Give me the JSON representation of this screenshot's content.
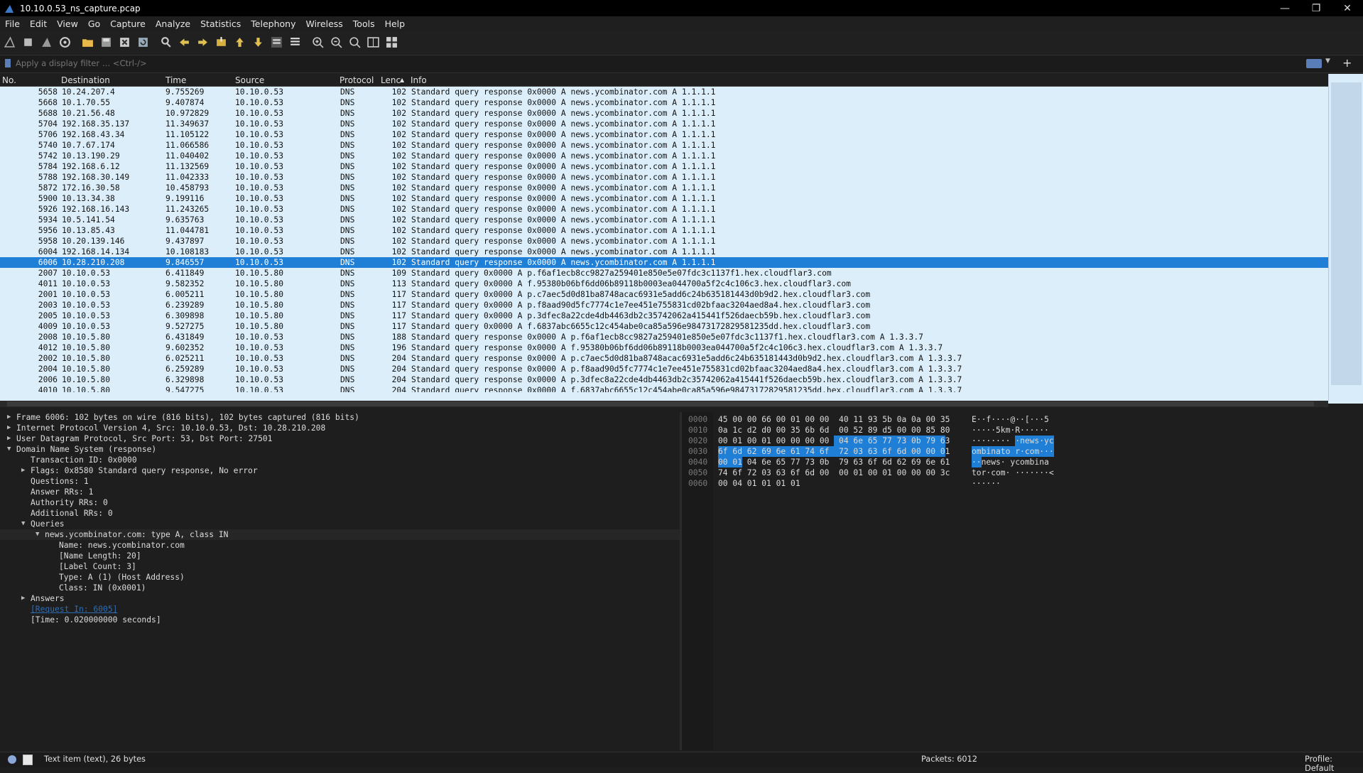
{
  "window": {
    "title": "10.10.0.53_ns_capture.pcap"
  },
  "menu": [
    "File",
    "Edit",
    "View",
    "Go",
    "Capture",
    "Analyze",
    "Statistics",
    "Telephony",
    "Wireless",
    "Tools",
    "Help"
  ],
  "filter": {
    "placeholder": "Apply a display filter … <Ctrl-/>"
  },
  "columns": {
    "no": "No.",
    "destination": "Destination",
    "time": "Time",
    "source": "Source",
    "protocol": "Protocol",
    "length": "Lenc",
    "info": "Info"
  },
  "packets": [
    {
      "no": "5658",
      "dst": "10.24.207.4",
      "time": "9.755269",
      "src": "10.10.0.53",
      "proto": "DNS",
      "len": "102",
      "info": "Standard query response 0x0000 A news.ycombinator.com A 1.1.1.1"
    },
    {
      "no": "5668",
      "dst": "10.1.70.55",
      "time": "9.407874",
      "src": "10.10.0.53",
      "proto": "DNS",
      "len": "102",
      "info": "Standard query response 0x0000 A news.ycombinator.com A 1.1.1.1"
    },
    {
      "no": "5688",
      "dst": "10.21.56.48",
      "time": "10.972829",
      "src": "10.10.0.53",
      "proto": "DNS",
      "len": "102",
      "info": "Standard query response 0x0000 A news.ycombinator.com A 1.1.1.1"
    },
    {
      "no": "5704",
      "dst": "192.168.35.137",
      "time": "11.349637",
      "src": "10.10.0.53",
      "proto": "DNS",
      "len": "102",
      "info": "Standard query response 0x0000 A news.ycombinator.com A 1.1.1.1"
    },
    {
      "no": "5706",
      "dst": "192.168.43.34",
      "time": "11.105122",
      "src": "10.10.0.53",
      "proto": "DNS",
      "len": "102",
      "info": "Standard query response 0x0000 A news.ycombinator.com A 1.1.1.1"
    },
    {
      "no": "5740",
      "dst": "10.7.67.174",
      "time": "11.066586",
      "src": "10.10.0.53",
      "proto": "DNS",
      "len": "102",
      "info": "Standard query response 0x0000 A news.ycombinator.com A 1.1.1.1"
    },
    {
      "no": "5742",
      "dst": "10.13.190.29",
      "time": "11.040402",
      "src": "10.10.0.53",
      "proto": "DNS",
      "len": "102",
      "info": "Standard query response 0x0000 A news.ycombinator.com A 1.1.1.1"
    },
    {
      "no": "5784",
      "dst": "192.168.6.12",
      "time": "11.132569",
      "src": "10.10.0.53",
      "proto": "DNS",
      "len": "102",
      "info": "Standard query response 0x0000 A news.ycombinator.com A 1.1.1.1"
    },
    {
      "no": "5788",
      "dst": "192.168.30.149",
      "time": "11.042333",
      "src": "10.10.0.53",
      "proto": "DNS",
      "len": "102",
      "info": "Standard query response 0x0000 A news.ycombinator.com A 1.1.1.1"
    },
    {
      "no": "5872",
      "dst": "172.16.30.58",
      "time": "10.458793",
      "src": "10.10.0.53",
      "proto": "DNS",
      "len": "102",
      "info": "Standard query response 0x0000 A news.ycombinator.com A 1.1.1.1"
    },
    {
      "no": "5900",
      "dst": "10.13.34.38",
      "time": "9.199116",
      "src": "10.10.0.53",
      "proto": "DNS",
      "len": "102",
      "info": "Standard query response 0x0000 A news.ycombinator.com A 1.1.1.1"
    },
    {
      "no": "5926",
      "dst": "192.168.16.143",
      "time": "11.243265",
      "src": "10.10.0.53",
      "proto": "DNS",
      "len": "102",
      "info": "Standard query response 0x0000 A news.ycombinator.com A 1.1.1.1"
    },
    {
      "no": "5934",
      "dst": "10.5.141.54",
      "time": "9.635763",
      "src": "10.10.0.53",
      "proto": "DNS",
      "len": "102",
      "info": "Standard query response 0x0000 A news.ycombinator.com A 1.1.1.1"
    },
    {
      "no": "5956",
      "dst": "10.13.85.43",
      "time": "11.044781",
      "src": "10.10.0.53",
      "proto": "DNS",
      "len": "102",
      "info": "Standard query response 0x0000 A news.ycombinator.com A 1.1.1.1"
    },
    {
      "no": "5958",
      "dst": "10.20.139.146",
      "time": "9.437897",
      "src": "10.10.0.53",
      "proto": "DNS",
      "len": "102",
      "info": "Standard query response 0x0000 A news.ycombinator.com A 1.1.1.1"
    },
    {
      "no": "6004",
      "dst": "192.168.14.134",
      "time": "10.108183",
      "src": "10.10.0.53",
      "proto": "DNS",
      "len": "102",
      "info": "Standard query response 0x0000 A news.ycombinator.com A 1.1.1.1"
    },
    {
      "no": "6006",
      "dst": "10.28.210.208",
      "time": "9.846557",
      "src": "10.10.0.53",
      "proto": "DNS",
      "len": "102",
      "info": "Standard query response 0x0000 A news.ycombinator.com A 1.1.1.1",
      "selected": true
    },
    {
      "no": "2007",
      "dst": "10.10.0.53",
      "time": "6.411849",
      "src": "10.10.5.80",
      "proto": "DNS",
      "len": "109",
      "info": "Standard query 0x0000 A p.f6af1ecb8cc9827a259401e850e5e07fdc3c1137f1.hex.cloudflar3.com"
    },
    {
      "no": "4011",
      "dst": "10.10.0.53",
      "time": "9.582352",
      "src": "10.10.5.80",
      "proto": "DNS",
      "len": "113",
      "info": "Standard query 0x0000 A f.95380b06bf6dd06b89118b0003ea044700a5f2c4c106c3.hex.cloudflar3.com"
    },
    {
      "no": "2001",
      "dst": "10.10.0.53",
      "time": "6.005211",
      "src": "10.10.5.80",
      "proto": "DNS",
      "len": "117",
      "info": "Standard query 0x0000 A p.c7aec5d0d81ba8748acac6931e5add6c24b635181443d0b9d2.hex.cloudflar3.com"
    },
    {
      "no": "2003",
      "dst": "10.10.0.53",
      "time": "6.239289",
      "src": "10.10.5.80",
      "proto": "DNS",
      "len": "117",
      "info": "Standard query 0x0000 A p.f8aad90d5fc7774c1e7ee451e755831cd02bfaac3204aed8a4.hex.cloudflar3.com"
    },
    {
      "no": "2005",
      "dst": "10.10.0.53",
      "time": "6.309898",
      "src": "10.10.5.80",
      "proto": "DNS",
      "len": "117",
      "info": "Standard query 0x0000 A p.3dfec8a22cde4db4463db2c35742062a415441f526daecb59b.hex.cloudflar3.com"
    },
    {
      "no": "4009",
      "dst": "10.10.0.53",
      "time": "9.527275",
      "src": "10.10.5.80",
      "proto": "DNS",
      "len": "117",
      "info": "Standard query 0x0000 A f.6837abc6655c12c454abe0ca85a596e98473172829581235dd.hex.cloudflar3.com"
    },
    {
      "no": "2008",
      "dst": "10.10.5.80",
      "time": "6.431849",
      "src": "10.10.0.53",
      "proto": "DNS",
      "len": "188",
      "info": "Standard query response 0x0000 A p.f6af1ecb8cc9827a259401e850e5e07fdc3c1137f1.hex.cloudflar3.com A 1.3.3.7"
    },
    {
      "no": "4012",
      "dst": "10.10.5.80",
      "time": "9.602352",
      "src": "10.10.0.53",
      "proto": "DNS",
      "len": "196",
      "info": "Standard query response 0x0000 A f.95380b06bf6dd06b89118b0003ea044700a5f2c4c106c3.hex.cloudflar3.com A 1.3.3.7"
    },
    {
      "no": "2002",
      "dst": "10.10.5.80",
      "time": "6.025211",
      "src": "10.10.0.53",
      "proto": "DNS",
      "len": "204",
      "info": "Standard query response 0x0000 A p.c7aec5d0d81ba8748acac6931e5add6c24b635181443d0b9d2.hex.cloudflar3.com A 1.3.3.7"
    },
    {
      "no": "2004",
      "dst": "10.10.5.80",
      "time": "6.259289",
      "src": "10.10.0.53",
      "proto": "DNS",
      "len": "204",
      "info": "Standard query response 0x0000 A p.f8aad90d5fc7774c1e7ee451e755831cd02bfaac3204aed8a4.hex.cloudflar3.com A 1.3.3.7"
    },
    {
      "no": "2006",
      "dst": "10.10.5.80",
      "time": "6.329898",
      "src": "10.10.0.53",
      "proto": "DNS",
      "len": "204",
      "info": "Standard query response 0x0000 A p.3dfec8a22cde4db4463db2c35742062a415441f526daecb59b.hex.cloudflar3.com A 1.3.3.7"
    },
    {
      "no": "4010",
      "dst": "10.10.5.80",
      "time": "9.547275",
      "src": "10.10.0.53",
      "proto": "DNS",
      "len": "204",
      "info": "Standard query response 0x0000 A f.6837abc6655c12c454abe0ca85a596e98473172829581235dd.hex.cloudflar3.com A 1.3.3.7"
    }
  ],
  "details": [
    {
      "indent": 0,
      "arrow": "closed",
      "text": "Frame 6006: 102 bytes on wire (816 bits), 102 bytes captured (816 bits)"
    },
    {
      "indent": 0,
      "arrow": "closed",
      "text": "Internet Protocol Version 4, Src: 10.10.0.53, Dst: 10.28.210.208"
    },
    {
      "indent": 0,
      "arrow": "closed",
      "text": "User Datagram Protocol, Src Port: 53, Dst Port: 27501"
    },
    {
      "indent": 0,
      "arrow": "open",
      "text": "Domain Name System (response)"
    },
    {
      "indent": 1,
      "arrow": "none",
      "text": "Transaction ID: 0x0000"
    },
    {
      "indent": 1,
      "arrow": "closed",
      "text": "Flags: 0x8580 Standard query response, No error"
    },
    {
      "indent": 1,
      "arrow": "none",
      "text": "Questions: 1"
    },
    {
      "indent": 1,
      "arrow": "none",
      "text": "Answer RRs: 1"
    },
    {
      "indent": 1,
      "arrow": "none",
      "text": "Authority RRs: 0"
    },
    {
      "indent": 1,
      "arrow": "none",
      "text": "Additional RRs: 0"
    },
    {
      "indent": 1,
      "arrow": "open",
      "text": "Queries"
    },
    {
      "indent": 2,
      "arrow": "open",
      "text": "news.ycombinator.com: type A, class IN",
      "highlight": true
    },
    {
      "indent": 3,
      "arrow": "none",
      "text": "Name: news.ycombinator.com"
    },
    {
      "indent": 3,
      "arrow": "none",
      "text": "[Name Length: 20]"
    },
    {
      "indent": 3,
      "arrow": "none",
      "text": "[Label Count: 3]"
    },
    {
      "indent": 3,
      "arrow": "none",
      "text": "Type: A (1) (Host Address)"
    },
    {
      "indent": 3,
      "arrow": "none",
      "text": "Class: IN (0x0001)"
    },
    {
      "indent": 1,
      "arrow": "closed",
      "text": "Answers"
    },
    {
      "indent": 1,
      "arrow": "none",
      "text": "[Request In: 6005]",
      "link": true
    },
    {
      "indent": 1,
      "arrow": "none",
      "text": "[Time: 0.020000000 seconds]"
    }
  ],
  "bytes": [
    {
      "off": "0000",
      "hex": "45 00 00 66 00 01 00 00  40 11 93 5b 0a 0a 00 35",
      "ascii": "E··f····@··[···5"
    },
    {
      "off": "0010",
      "hex": "0a 1c d2 d0 00 35 6b 6d  00 52 89 d5 00 00 85 80",
      "ascii": "·····5km·R······"
    },
    {
      "off": "0020",
      "hex": "00 01 00 01 00 00 00 00  04 6e 65 77 73 0b 79 63",
      "ascii": "········ ·news·yc"
    },
    {
      "off": "0030",
      "hex": "6f 6d 62 69 6e 61 74 6f  72 03 63 6f 6d 00 00 01",
      "ascii": "ombinato r·com···"
    },
    {
      "off": "0040",
      "hex": "00 01 04 6e 65 77 73 0b  79 63 6f 6d 62 69 6e 61",
      "ascii": "··news· ycombina"
    },
    {
      "off": "0050",
      "hex": "74 6f 72 03 63 6f 6d 00  00 01 00 01 00 00 00 3c",
      "ascii": "tor·com· ·······<"
    },
    {
      "off": "0060",
      "hex": "00 04 01 01 01 01",
      "ascii": "······"
    }
  ],
  "status": {
    "message": "Text item (text), 26 bytes",
    "packets": "Packets: 6012",
    "profile": "Profile: Default"
  },
  "colors": {
    "selected_row": "#1f7fd6",
    "row_bg": "#dbeefa",
    "dark_bg": "#1e1e1e"
  }
}
